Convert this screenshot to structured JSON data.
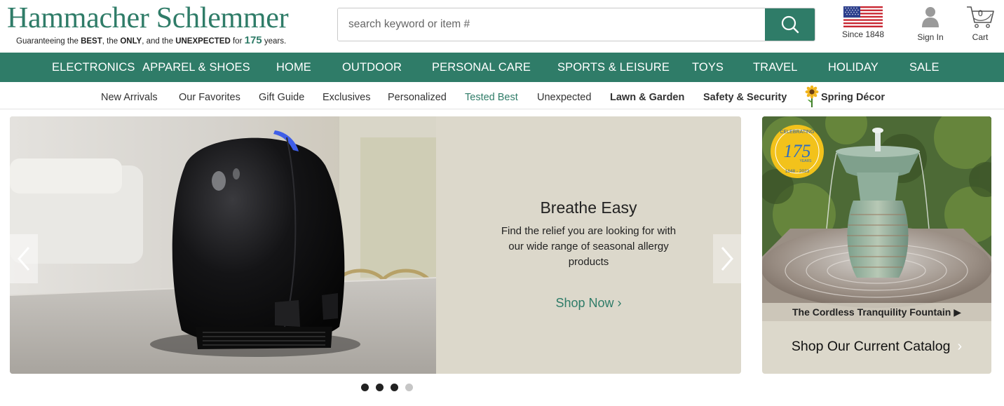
{
  "header": {
    "logo_name": "Hammacher Schlemmer",
    "tagline_parts": [
      "Guaranteeing the ",
      "BEST",
      ", the ",
      "ONLY",
      ", and the ",
      "UNEXPECTED",
      " for ",
      "175",
      " years."
    ],
    "search_placeholder": "search keyword or item #",
    "since_label": "Since 1848",
    "signin_label": "Sign In",
    "cart_label": "Cart",
    "cart_count": "0"
  },
  "main_nav": [
    "ELECTRONICS",
    "APPAREL & SHOES",
    "HOME",
    "OUTDOOR",
    "PERSONAL CARE",
    "SPORTS & LEISURE",
    "TOYS",
    "TRAVEL",
    "HOLIDAY",
    "SALE"
  ],
  "sub_nav": [
    "New Arrivals",
    "Our Favorites",
    "Gift Guide",
    "Exclusives",
    "Personalized",
    "Tested Best",
    "Unexpected",
    "Lawn & Garden",
    "Safety & Security",
    "Spring Décor"
  ],
  "hero": {
    "title": "Breathe Easy",
    "description": "Find the relief you are looking for with our wide range of seasonal allergy products",
    "cta": "Shop Now ›",
    "slide_count": 4,
    "active_slide": 3
  },
  "side_promo": {
    "badge_top": "CELEBRATING",
    "badge_number": "175",
    "badge_years": "YEARS",
    "badge_dates": "1848 - 2023",
    "caption": "The Cordless Tranquility Fountain ▶",
    "cta": "Shop Our Current Catalog",
    "cta_chevron": "›"
  },
  "colors": {
    "brand_green": "#2f7c68",
    "panel_beige": "#dcd8cb"
  }
}
